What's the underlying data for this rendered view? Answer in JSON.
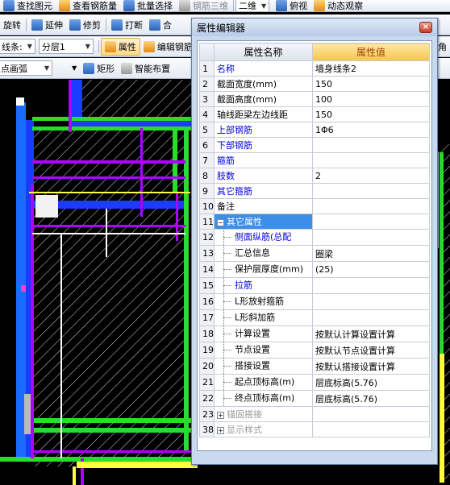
{
  "toolbar_top": {
    "find_label": "查找图元",
    "view_rebar_label": "查看钢筋量",
    "batch_select_label": "批量选择",
    "rebar_3d_label": "钢筋三维",
    "view_mode": "二维",
    "overlook_label": "俯视",
    "dynamic_label": "动态观察"
  },
  "toolbar_edit": {
    "rotate_label": "旋转",
    "extend_label": "延伸",
    "trim_label": "修剪",
    "break_label": "打断",
    "merge_label": "合"
  },
  "toolbar_layer": {
    "type_combo": "线条:",
    "floor_combo": "分层1",
    "property_label": "属性",
    "edit_rebar_label": "编辑钢筋",
    "right_fragment": "角"
  },
  "toolbar_draw": {
    "arc_combo": "点画弧",
    "rect_label": "矩形",
    "smart_layout_label": "智能布置"
  },
  "property_editor": {
    "title": "属性编辑器",
    "close_glyph": "×",
    "col_name": "属性名称",
    "col_value": "属性值",
    "rows": [
      {
        "num": "1",
        "name": "名称",
        "value": "墙身线条2",
        "style": "blue"
      },
      {
        "num": "2",
        "name": "截面宽度(mm)",
        "value": "150",
        "style": "black"
      },
      {
        "num": "3",
        "name": "截面高度(mm)",
        "value": "100",
        "style": "black"
      },
      {
        "num": "4",
        "name": "轴线距梁左边线距",
        "value": "150",
        "style": "black"
      },
      {
        "num": "5",
        "name": "上部钢筋",
        "value": "1Φ6",
        "style": "blue"
      },
      {
        "num": "6",
        "name": "下部钢筋",
        "value": "",
        "style": "blue"
      },
      {
        "num": "7",
        "name": "箍筋",
        "value": "",
        "style": "blue"
      },
      {
        "num": "8",
        "name": "肢数",
        "value": "2",
        "style": "blue"
      },
      {
        "num": "9",
        "name": "其它箍筋",
        "value": "",
        "style": "blue"
      },
      {
        "num": "10",
        "name": "备注",
        "value": "",
        "style": "black"
      },
      {
        "num": "11",
        "name": "其它属性",
        "value": "",
        "style": "group-open"
      },
      {
        "num": "12",
        "name": "侧面纵筋(总配",
        "value": "",
        "style": "child-blue"
      },
      {
        "num": "13",
        "name": "汇总信息",
        "value": "圈梁",
        "style": "child"
      },
      {
        "num": "14",
        "name": "保护层厚度(mm)",
        "value": "(25)",
        "style": "child"
      },
      {
        "num": "15",
        "name": "拉筋",
        "value": "",
        "style": "child-blue"
      },
      {
        "num": "16",
        "name": "L形放射箍筋",
        "value": "",
        "style": "child"
      },
      {
        "num": "17",
        "name": "L形斜加筋",
        "value": "",
        "style": "child"
      },
      {
        "num": "18",
        "name": "计算设置",
        "value": "按默认计算设置计算",
        "style": "child"
      },
      {
        "num": "19",
        "name": "节点设置",
        "value": "按默认节点设置计算",
        "style": "child"
      },
      {
        "num": "20",
        "name": "搭接设置",
        "value": "按默认搭接设置计算",
        "style": "child"
      },
      {
        "num": "21",
        "name": "起点顶标高(m)",
        "value": "层底标高(5.76)",
        "style": "child"
      },
      {
        "num": "22",
        "name": "终点顶标高(m)",
        "value": "层底标高(5.76)",
        "style": "child"
      },
      {
        "num": "23",
        "name": "锚固搭接",
        "value": "",
        "style": "group-closed"
      },
      {
        "num": "38",
        "name": "显示样式",
        "value": "",
        "style": "group-closed"
      }
    ]
  },
  "colors": {
    "canvas_bg": "#000000",
    "wall_blue": "#1a3cff",
    "beam_green": "#2bdc2b",
    "rebar_purple": "#b000ff",
    "axis_yellow": "#ffff40",
    "selected_row": "#3d8ee6"
  }
}
